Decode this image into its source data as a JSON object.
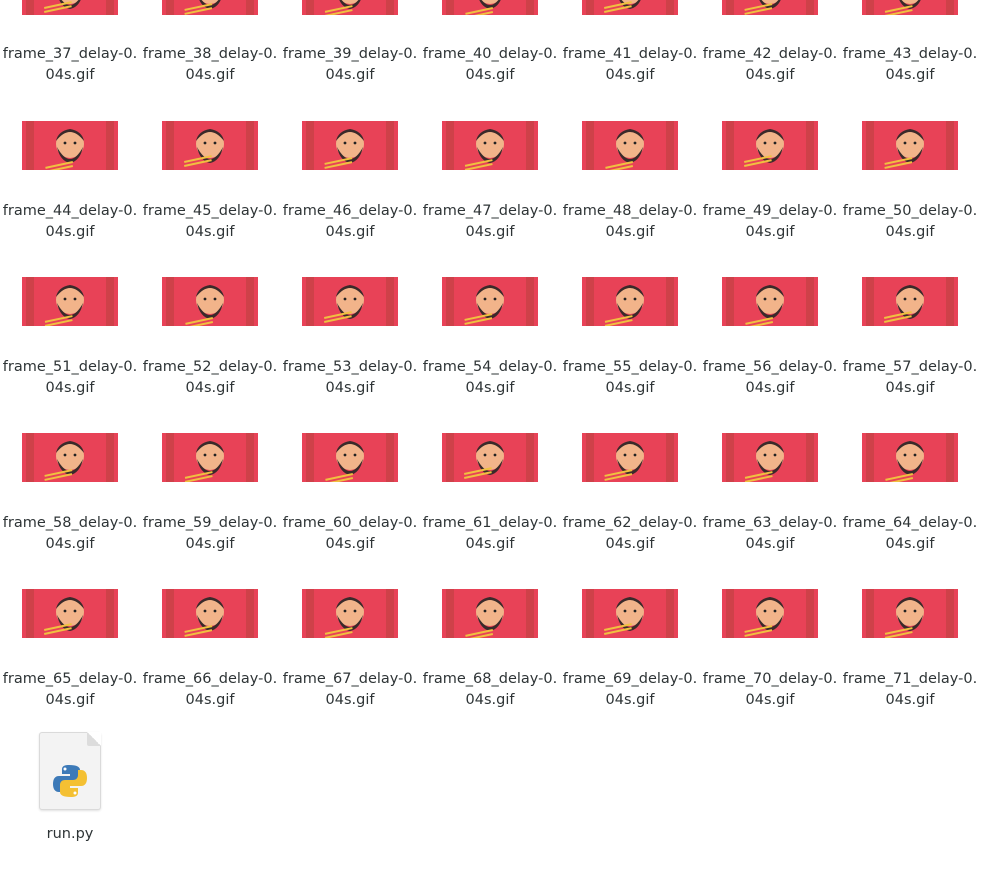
{
  "files": [
    {
      "name": "frame_37_delay-0.04s.gif",
      "crop": "top"
    },
    {
      "name": "frame_38_delay-0.04s.gif",
      "crop": "top"
    },
    {
      "name": "frame_39_delay-0.04s.gif",
      "crop": "top"
    },
    {
      "name": "frame_40_delay-0.04s.gif",
      "crop": "top"
    },
    {
      "name": "frame_41_delay-0.04s.gif",
      "crop": "top"
    },
    {
      "name": "frame_42_delay-0.04s.gif",
      "crop": "top"
    },
    {
      "name": "frame_43_delay-0.04s.gif",
      "crop": "top"
    },
    {
      "name": "frame_44_delay-0.04s.gif"
    },
    {
      "name": "frame_45_delay-0.04s.gif"
    },
    {
      "name": "frame_46_delay-0.04s.gif"
    },
    {
      "name": "frame_47_delay-0.04s.gif"
    },
    {
      "name": "frame_48_delay-0.04s.gif"
    },
    {
      "name": "frame_49_delay-0.04s.gif"
    },
    {
      "name": "frame_50_delay-0.04s.gif"
    },
    {
      "name": "frame_51_delay-0.04s.gif"
    },
    {
      "name": "frame_52_delay-0.04s.gif"
    },
    {
      "name": "frame_53_delay-0.04s.gif"
    },
    {
      "name": "frame_54_delay-0.04s.gif"
    },
    {
      "name": "frame_55_delay-0.04s.gif"
    },
    {
      "name": "frame_56_delay-0.04s.gif"
    },
    {
      "name": "frame_57_delay-0.04s.gif"
    },
    {
      "name": "frame_58_delay-0.04s.gif"
    },
    {
      "name": "frame_59_delay-0.04s.gif"
    },
    {
      "name": "frame_60_delay-0.04s.gif"
    },
    {
      "name": "frame_61_delay-0.04s.gif"
    },
    {
      "name": "frame_62_delay-0.04s.gif"
    },
    {
      "name": "frame_63_delay-0.04s.gif"
    },
    {
      "name": "frame_64_delay-0.04s.gif"
    },
    {
      "name": "frame_65_delay-0.04s.gif"
    },
    {
      "name": "frame_66_delay-0.04s.gif"
    },
    {
      "name": "frame_67_delay-0.04s.gif"
    },
    {
      "name": "frame_68_delay-0.04s.gif"
    },
    {
      "name": "frame_69_delay-0.04s.gif"
    },
    {
      "name": "frame_70_delay-0.04s.gif"
    },
    {
      "name": "frame_71_delay-0.04s.gif"
    },
    {
      "name": "run.py",
      "type": "python"
    }
  ],
  "colors": {
    "bg_red": "#e84257",
    "skin": "#f2b48a",
    "beard": "#3a2a2a",
    "shirt": "#3a67c9",
    "wall": "#b8413e",
    "bowl": "#f5ece0"
  },
  "icons": {
    "python": "python-script-icon"
  }
}
